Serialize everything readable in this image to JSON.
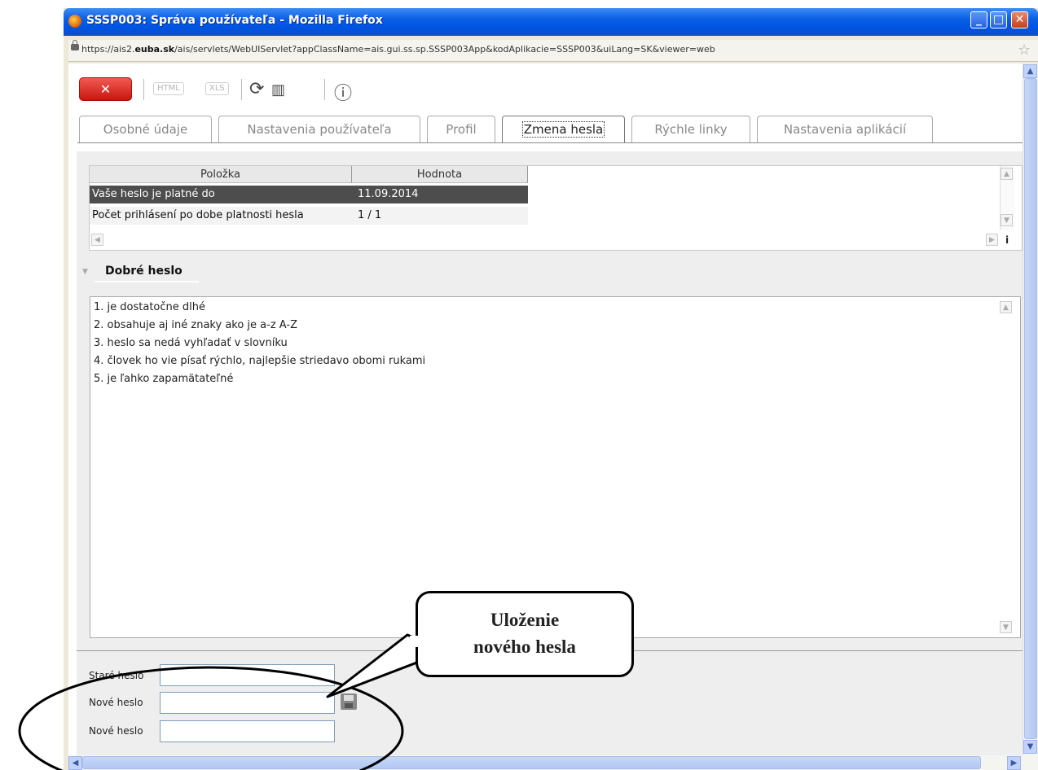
{
  "window": {
    "title": "SSSP003: Správa používateľa - Mozilla Firefox",
    "controls": {
      "minimize": "_",
      "maximize": "□",
      "close": "✕"
    }
  },
  "urlbar": {
    "url_prefix": "https://ais2.",
    "url_domain": "euba.sk",
    "url_rest": "/ais/servlets/WebUIServlet?appClassName=ais.gui.ss.sp.SSSP003App&kodAplikacie=SSSP003&uiLang=SK&viewer=web"
  },
  "toolbar": {
    "close_label": "✕",
    "html_label": "HTML",
    "xls_label": "XLS",
    "refresh_icon": "⟳",
    "grid_icon": "▥",
    "info_icon": "ⓘ"
  },
  "tabs": [
    {
      "label": "Osobné údaje"
    },
    {
      "label": "Nastavenia používateľa"
    },
    {
      "label": "Profil"
    },
    {
      "label": "Zmena hesla",
      "active": true
    },
    {
      "label": "Rýchle linky"
    },
    {
      "label": "Nastavenia aplikácií"
    }
  ],
  "table": {
    "headers": [
      "Položka",
      "Hodnota"
    ],
    "rows": [
      {
        "item": "Vaše heslo je platné do",
        "value": "11.09.2014"
      },
      {
        "item": "Počet prihlásení po dobe platnosti hesla",
        "value": "1 / 1"
      }
    ],
    "info_label": "i"
  },
  "section": {
    "title": "Dobré heslo",
    "lines": [
      "1. je dostatočne dlhé",
      "2. obsahuje aj iné znaky ako je a-z A-Z",
      "3. heslo sa nedá vyhľadať v slovníku",
      "4. človek ho vie písať rýchlo, najlepšie striedavo obomi rukami",
      "5. je ľahko zapamätateľné"
    ]
  },
  "form": {
    "old_password_label": "Staré heslo",
    "new_password_label": "Nové heslo",
    "confirm_password_label": "Nové heslo",
    "old_password_value": "",
    "new_password_value": "",
    "confirm_password_value": ""
  },
  "callout": {
    "line1": "Uloženie",
    "line2": "nového hesla"
  }
}
